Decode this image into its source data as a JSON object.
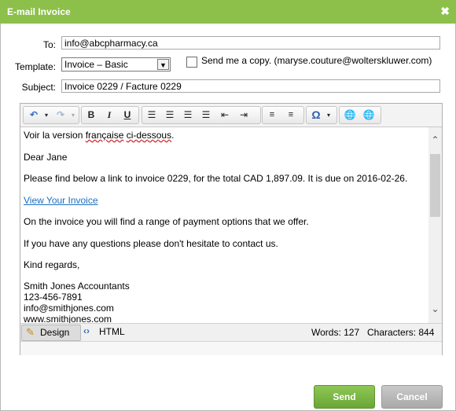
{
  "window": {
    "title": "E-mail Invoice",
    "close_glyph": "✖"
  },
  "form": {
    "to_label": "To:",
    "to_value": "info@abcpharmacy.ca",
    "template_label": "Template:",
    "template_value": "Invoice – Basic",
    "send_copy_label": "Send me a copy. (maryse.couture@wolterskluwer.com)",
    "send_copy_checked": false,
    "subject_label": "Subject:",
    "subject_value": "Invoice 0229 / Facture  0229"
  },
  "toolbar": {
    "icons": [
      "undo-icon",
      "redo-icon",
      "bold-icon",
      "italic-icon",
      "underline-icon",
      "align-left-icon",
      "align-center-icon",
      "align-right-icon",
      "align-justify-icon",
      "outdent-icon",
      "indent-icon",
      "numbered-list-icon",
      "bullet-list-icon",
      "special-char-icon",
      "link-icon",
      "unlink-icon"
    ]
  },
  "body": {
    "line1_a": "Voir la version ",
    "line1_b": "française",
    "line1_c": " ",
    "line1_d": "ci-dessous",
    "line1_e": ".",
    "greeting": "Dear Jane",
    "para1": "Please find below a link to invoice 0229, for the total CAD 1,897.09. It is due on 2016-02-26.",
    "link": "View Your Invoice",
    "para2": "On the invoice you will find a range of payment options that we offer.",
    "para3": "If you have any questions please don't hesitate to contact us.",
    "closing": "Kind regards,",
    "sig_name": "Smith Jones Accountants",
    "sig_phone": "123-456-7891",
    "sig_email": "info@smithjones.com",
    "sig_web": "www.smithjones.com"
  },
  "modes": {
    "design": "Design",
    "html": "HTML"
  },
  "stats": {
    "words": "Words: 127",
    "chars": "Characters: 844"
  },
  "buttons": {
    "send": "Send",
    "cancel": "Cancel"
  },
  "colors": {
    "title_bar": "#8cc04a",
    "send": "#77b043",
    "cancel": "#b5b5b5",
    "link": "#1a6fc0"
  }
}
